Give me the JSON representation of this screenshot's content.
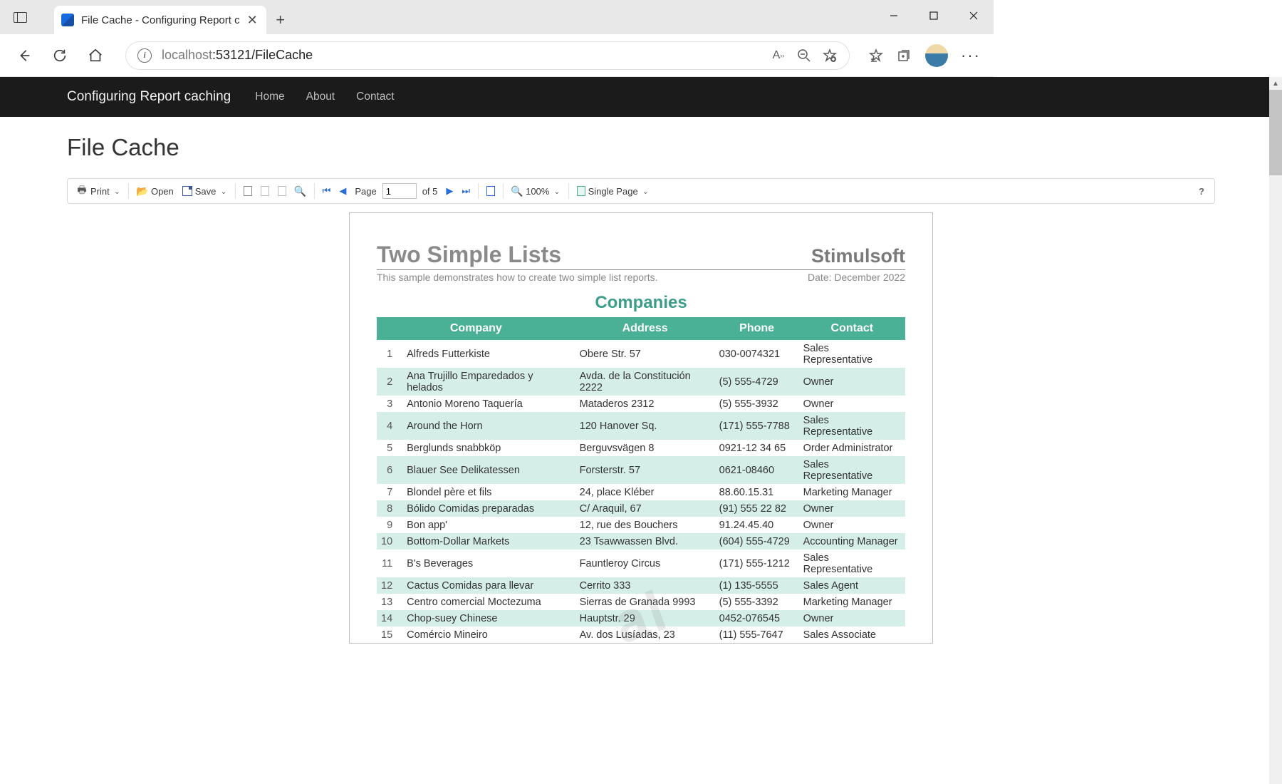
{
  "browser": {
    "tab_title": "File Cache - Configuring Report c",
    "url_host": "localhost",
    "url_port_path": ":53121/FileCache"
  },
  "nav": {
    "brand": "Configuring Report caching",
    "links": [
      "Home",
      "About",
      "Contact"
    ]
  },
  "page": {
    "heading": "File Cache"
  },
  "toolbar": {
    "print": "Print",
    "open": "Open",
    "save": "Save",
    "page_label": "Page",
    "page_value": "1",
    "page_of": "of 5",
    "zoom": "100%",
    "view_mode": "Single Page",
    "help": "?"
  },
  "report": {
    "title": "Two Simple Lists",
    "brand": "Stimulsoft",
    "subtitle": "This sample demonstrates how to create two simple list reports.",
    "date": "Date: December 2022",
    "section": "Companies",
    "columns": [
      "Company",
      "Address",
      "Phone",
      "Contact"
    ],
    "rows": [
      {
        "n": "1",
        "company": "Alfreds Futterkiste",
        "address": "Obere Str. 57",
        "phone": "030-0074321",
        "contact": "Sales Representative"
      },
      {
        "n": "2",
        "company": "Ana Trujillo Emparedados y helados",
        "address": "Avda. de la Constitución 2222",
        "phone": "(5) 555-4729",
        "contact": "Owner"
      },
      {
        "n": "3",
        "company": "Antonio Moreno Taquería",
        "address": "Mataderos 2312",
        "phone": "(5) 555-3932",
        "contact": "Owner"
      },
      {
        "n": "4",
        "company": "Around the Horn",
        "address": "120 Hanover Sq.",
        "phone": "(171) 555-7788",
        "contact": "Sales Representative"
      },
      {
        "n": "5",
        "company": "Berglunds snabbköp",
        "address": "Berguvsvägen 8",
        "phone": "0921-12 34 65",
        "contact": "Order Administrator"
      },
      {
        "n": "6",
        "company": "Blauer See Delikatessen",
        "address": "Forsterstr. 57",
        "phone": "0621-08460",
        "contact": "Sales Representative"
      },
      {
        "n": "7",
        "company": "Blondel père et fils",
        "address": "24, place Kléber",
        "phone": "88.60.15.31",
        "contact": "Marketing Manager"
      },
      {
        "n": "8",
        "company": "Bólido Comidas preparadas",
        "address": "C/ Araquil, 67",
        "phone": "(91) 555 22 82",
        "contact": "Owner"
      },
      {
        "n": "9",
        "company": "Bon app'",
        "address": "12, rue des Bouchers",
        "phone": "91.24.45.40",
        "contact": "Owner"
      },
      {
        "n": "10",
        "company": "Bottom-Dollar Markets",
        "address": "23 Tsawwassen Blvd.",
        "phone": "(604) 555-4729",
        "contact": "Accounting Manager"
      },
      {
        "n": "11",
        "company": "B's Beverages",
        "address": "Fauntleroy Circus",
        "phone": "(171) 555-1212",
        "contact": "Sales Representative"
      },
      {
        "n": "12",
        "company": "Cactus Comidas para llevar",
        "address": "Cerrito 333",
        "phone": "(1) 135-5555",
        "contact": "Sales Agent"
      },
      {
        "n": "13",
        "company": "Centro comercial Moctezuma",
        "address": "Sierras de Granada 9993",
        "phone": "(5) 555-3392",
        "contact": "Marketing Manager"
      },
      {
        "n": "14",
        "company": "Chop-suey Chinese",
        "address": "Hauptstr. 29",
        "phone": "0452-076545",
        "contact": "Owner"
      },
      {
        "n": "15",
        "company": "Comércio Mineiro",
        "address": "Av. dos Lusíadas, 23",
        "phone": "(11) 555-7647",
        "contact": "Sales Associate"
      }
    ]
  }
}
